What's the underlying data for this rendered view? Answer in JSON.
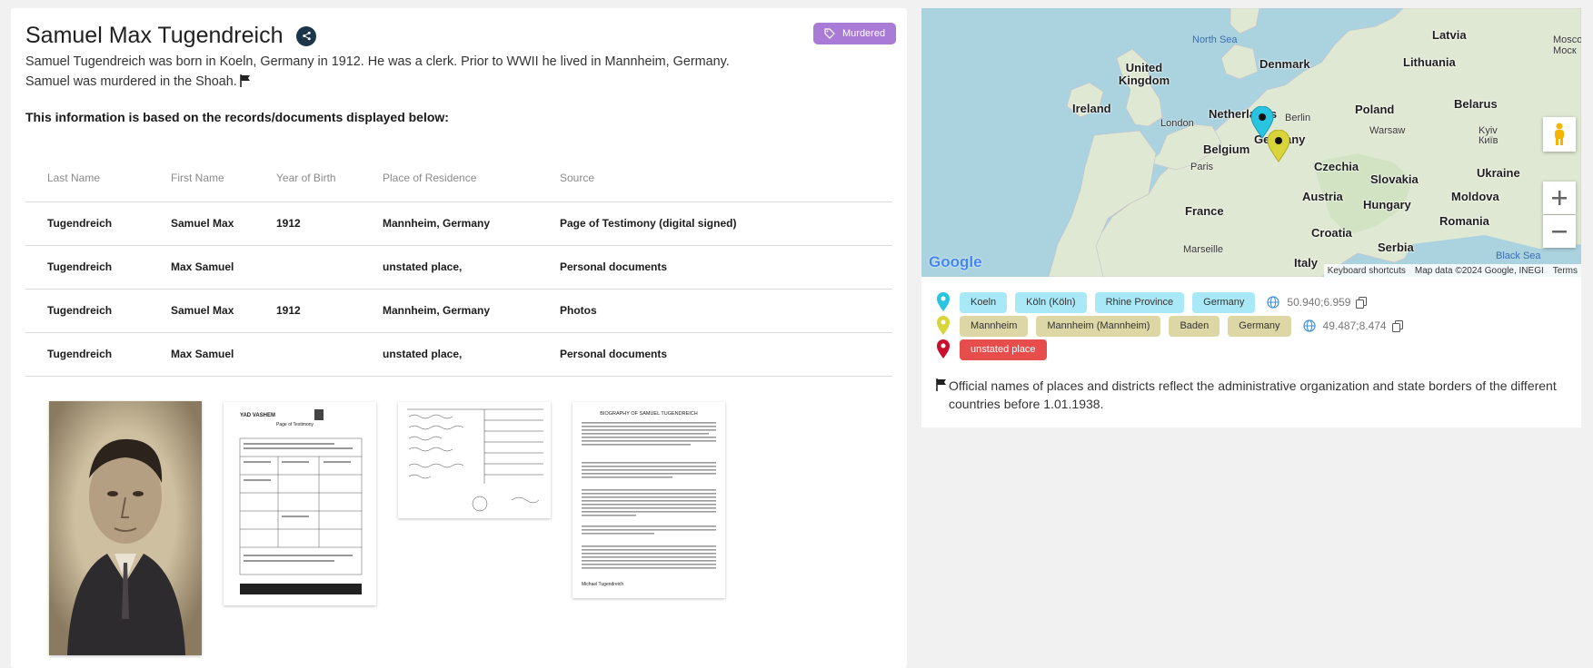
{
  "person": {
    "name": "Samuel Max Tugendreich",
    "status_badge": "Murdered",
    "bio_line1": "Samuel Tugendreich was born in Koeln, Germany in 1912. He was a clerk. Prior to WWII he lived in Mannheim, Germany.",
    "bio_line2": "Samuel was murdered in the Shoah."
  },
  "records": {
    "heading": "This information is based on the records/documents displayed below:",
    "columns": [
      "Last Name",
      "First Name",
      "Year of Birth",
      "Place of Residence",
      "Source"
    ],
    "rows": [
      [
        "Tugendreich",
        "Samuel Max",
        "1912",
        "Mannheim, Germany",
        "Page of Testimony (digital signed)"
      ],
      [
        "Tugendreich",
        "Max Samuel",
        "",
        "unstated place,",
        "Personal documents"
      ],
      [
        "Tugendreich",
        "Samuel Max",
        "1912",
        "Mannheim, Germany",
        "Photos"
      ],
      [
        "Tugendreich",
        "Max Samuel",
        "",
        "unstated place,",
        "Personal documents"
      ]
    ]
  },
  "documents": {
    "testimony_org": "YAD VASHEM",
    "testimony_title": "Page of Testimony",
    "biography_title": "BIOGRAPHY OF SAMUEL TUGENDREICH",
    "biography_signature": "Michael Tugendreich"
  },
  "map": {
    "countries": [
      "Latvia",
      "Lithuania",
      "Denmark",
      "United Kingdom",
      "Ireland",
      "Netherlands",
      "Poland",
      "Belarus",
      "Belgium",
      "Germany",
      "Czechia",
      "Slovakia",
      "Ukraine",
      "France",
      "Austria",
      "Hungary",
      "Moldova",
      "Romania",
      "Croatia",
      "Serbia",
      "Italy"
    ],
    "cities": [
      "London",
      "Berlin",
      "Warsaw",
      "Paris",
      "Kyiv",
      "Київ",
      "Marseille",
      "Moscow",
      "Моск"
    ],
    "seas": [
      "North Sea",
      "Black Sea"
    ],
    "footer": {
      "shortcuts": "Keyboard shortcuts",
      "data": "Map data ©2024 Google, INEGI",
      "terms": "Terms"
    },
    "logo": "Google"
  },
  "places": {
    "birth": {
      "chips": [
        "Koeln",
        "Köln (Köln)",
        "Rhine Province",
        "Germany"
      ],
      "coords": "50.940;6.959",
      "pin_color": "#29c4e0"
    },
    "residence": {
      "chips": [
        "Mannheim",
        "Mannheim (Mannheim)",
        "Baden",
        "Germany"
      ],
      "coords": "49.487;8.474",
      "pin_color": "#d9d43a"
    },
    "death": {
      "chips": [
        "unstated place"
      ],
      "pin_color": "#c8102e"
    },
    "note": "Official names of places and districts reflect the administrative organization and state borders of the different countries before 1.01.1938."
  }
}
